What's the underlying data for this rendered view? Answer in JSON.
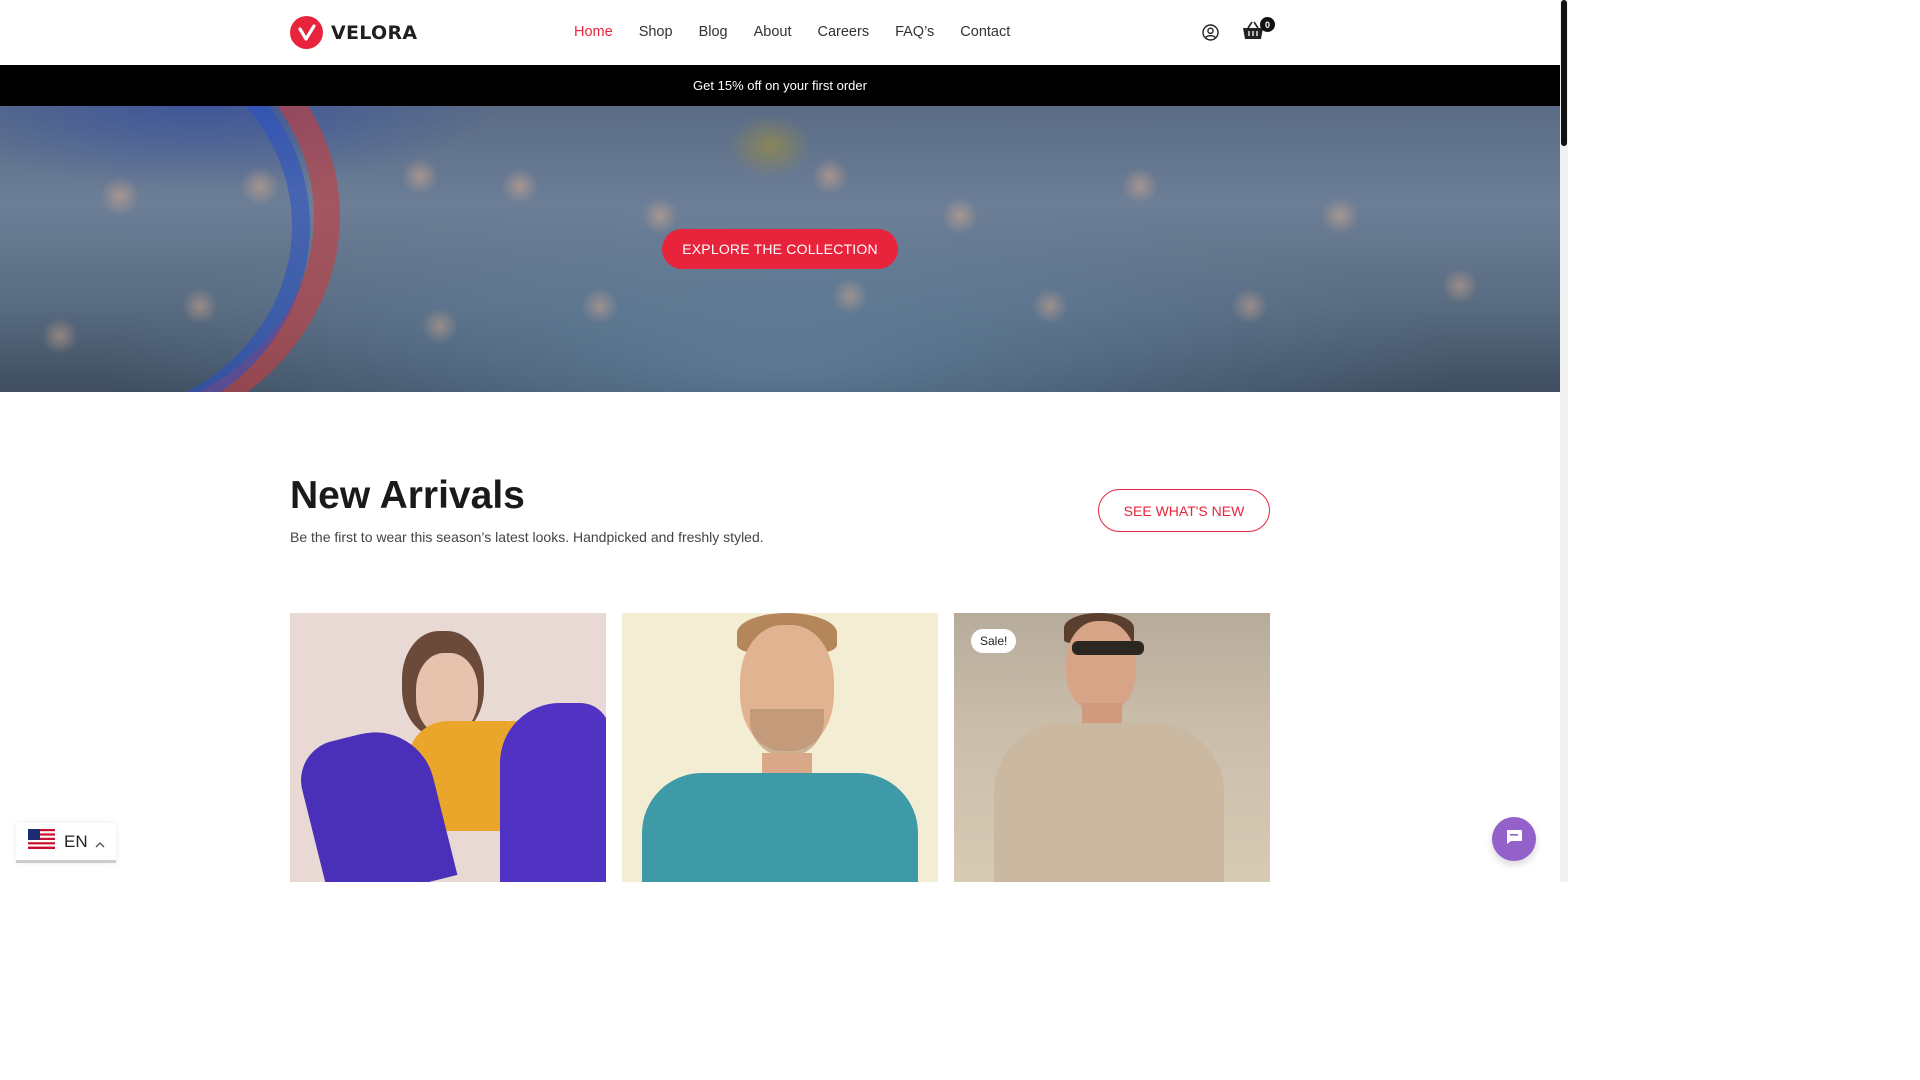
{
  "brand": {
    "name": "VELORA",
    "accent": "#e8243c"
  },
  "nav": {
    "items": [
      "Home",
      "Shop",
      "Blog",
      "About",
      "Careers",
      "FAQ’s",
      "Contact"
    ],
    "active": "Home"
  },
  "header": {
    "user_icon": "user-circle-icon",
    "cart_icon": "basket-icon",
    "cart_count": "0"
  },
  "promo": {
    "text": "Get 15% off on your first order"
  },
  "hero": {
    "cta_label": "EXPLORE THE COLLECTION"
  },
  "new_arrivals": {
    "title": "New Arrivals",
    "subtitle": "Be the first to wear this season’s latest looks. Handpicked and freshly styled.",
    "button_label": "SEE WHAT'S NEW"
  },
  "products": [
    {
      "badge": ""
    },
    {
      "badge": ""
    },
    {
      "badge": "Sale!"
    }
  ],
  "language": {
    "code": "EN",
    "flag_icon": "us-flag-icon"
  },
  "chat": {
    "icon": "chat-icon",
    "color": "#9460c9"
  }
}
